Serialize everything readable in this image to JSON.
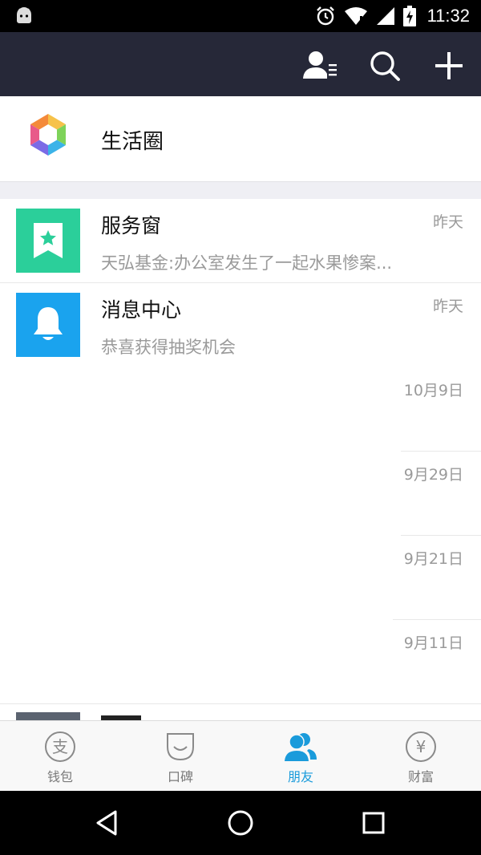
{
  "status_bar": {
    "time": "11:32",
    "icons": [
      "android-icon",
      "alarm-icon",
      "wifi-icon",
      "signal-icon",
      "battery-charging-icon"
    ]
  },
  "toolbar": {
    "buttons": [
      "contacts-icon",
      "search-icon",
      "add-icon"
    ]
  },
  "life_circle": {
    "label": "生活圈"
  },
  "conversations": [
    {
      "icon": "service-window-icon",
      "icon_color": "#2bcf9a",
      "title": "服务窗",
      "subtitle": "天弘基金:办公室发生了一起水果惨案...",
      "time": "昨天"
    },
    {
      "icon": "bell-icon",
      "icon_color": "#1aa3ee",
      "title": "消息中心",
      "subtitle": "恭喜获得抽奖机会",
      "time": "昨天"
    },
    {
      "title": "",
      "subtitle": "",
      "time": "10月9日"
    },
    {
      "title": "",
      "subtitle": "",
      "time": "9月29日"
    },
    {
      "title": "",
      "subtitle": "",
      "time": "9月21日"
    },
    {
      "title": "",
      "subtitle": "",
      "time": "9月11日"
    }
  ],
  "tabbar": {
    "active_color": "#1a9bdb",
    "tabs": [
      {
        "label": "钱包",
        "icon": "wallet-icon"
      },
      {
        "label": "口碑",
        "icon": "koubei-icon"
      },
      {
        "label": "朋友",
        "icon": "friends-icon"
      },
      {
        "label": "财富",
        "icon": "wealth-icon"
      }
    ]
  },
  "nav_bar": {
    "buttons": [
      "back-icon",
      "home-icon",
      "recents-icon"
    ]
  }
}
